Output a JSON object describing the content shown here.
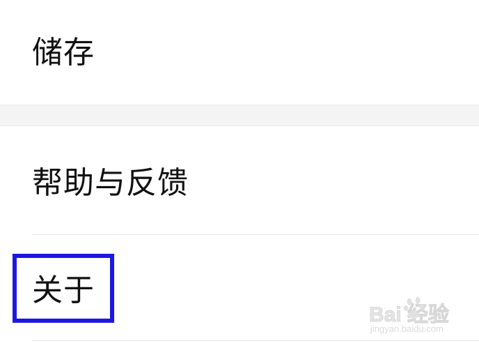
{
  "settings": {
    "items": [
      {
        "label": "储存"
      },
      {
        "label": "帮助与反馈"
      },
      {
        "label": "关于"
      }
    ]
  },
  "watermark": {
    "brand": "Bai 经验",
    "url": "jingyan.baidu.com"
  },
  "colors": {
    "highlight": "#1c18e0",
    "section_gap": "#f4f4f4",
    "divider": "#e6e6e6"
  }
}
